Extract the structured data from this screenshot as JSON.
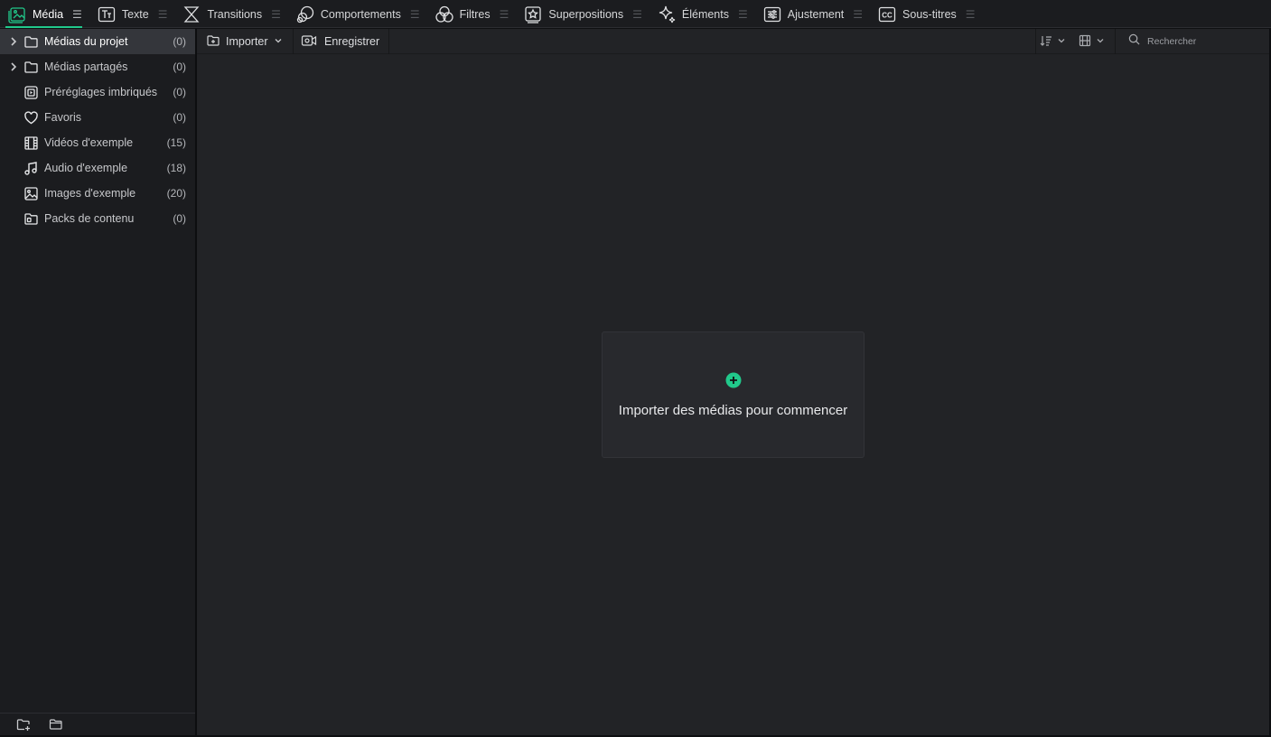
{
  "tabs": [
    {
      "label": "Média",
      "icon": "media-icon",
      "active": true
    },
    {
      "label": "Texte",
      "icon": "text-icon",
      "active": false
    },
    {
      "label": "Transitions",
      "icon": "transitions-icon",
      "active": false
    },
    {
      "label": "Comportements",
      "icon": "behaviors-icon",
      "active": false
    },
    {
      "label": "Filtres",
      "icon": "filters-icon",
      "active": false
    },
    {
      "label": "Superpositions",
      "icon": "overlays-icon",
      "active": false
    },
    {
      "label": "Éléments",
      "icon": "elements-icon",
      "active": false
    },
    {
      "label": "Ajustement",
      "icon": "adjustment-icon",
      "active": false
    },
    {
      "label": "Sous-titres",
      "icon": "subtitles-icon",
      "active": false
    }
  ],
  "sidebar": {
    "items": [
      {
        "label": "Médias du projet",
        "count": "(0)",
        "icon": "folder-icon",
        "expandable": true,
        "selected": true
      },
      {
        "label": "Médias partagés",
        "count": "(0)",
        "icon": "folder-icon",
        "expandable": true,
        "selected": false
      },
      {
        "label": "Préréglages imbriqués",
        "count": "(0)",
        "icon": "nested-presets-icon",
        "expandable": false,
        "selected": false
      },
      {
        "label": "Favoris",
        "count": "(0)",
        "icon": "heart-icon",
        "expandable": false,
        "selected": false
      },
      {
        "label": "Vidéos d'exemple",
        "count": "(15)",
        "icon": "film-icon",
        "expandable": false,
        "selected": false
      },
      {
        "label": "Audio d'exemple",
        "count": "(18)",
        "icon": "music-note-icon",
        "expandable": false,
        "selected": false
      },
      {
        "label": "Images d'exemple",
        "count": "(20)",
        "icon": "image-icon",
        "expandable": false,
        "selected": false
      },
      {
        "label": "Packs de contenu",
        "count": "(0)",
        "icon": "content-pack-icon",
        "expandable": false,
        "selected": false
      }
    ],
    "footer": {
      "add_folder_icon": "add-folder-icon",
      "folder_icon": "folder-outline-icon"
    }
  },
  "toolbar": {
    "import_label": "Importer",
    "record_label": "Enregistrer",
    "search_placeholder": "Rechercher"
  },
  "empty_state": {
    "message": "Importer des médias pour commencer"
  },
  "colors": {
    "accent": "#21c98b",
    "background": "#222326",
    "sidebar": "#1b1c1f",
    "selected": "#34363b"
  }
}
